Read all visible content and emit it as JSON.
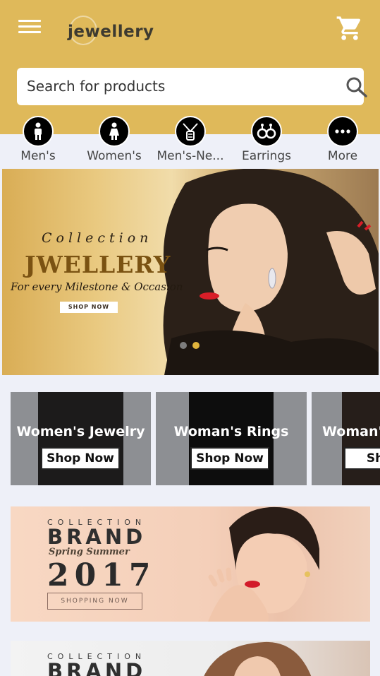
{
  "header": {
    "logo_text": "jewellery",
    "menu_icon": "hamburger-menu-icon",
    "cart_icon": "shopping-cart-icon",
    "background": "#dfb95a"
  },
  "search": {
    "placeholder": "Search for products",
    "value": ""
  },
  "categories": [
    {
      "label": "Men's",
      "icon": "man-icon"
    },
    {
      "label": "Women's",
      "icon": "woman-icon"
    },
    {
      "label": "Men's-Ne...",
      "icon": "necklace-icon"
    },
    {
      "label": "Earrings",
      "icon": "earrings-icon"
    },
    {
      "label": "More",
      "icon": "more-dots-icon"
    }
  ],
  "hero": {
    "collection": "Collection",
    "title": "JWELLERY",
    "subtitle": "For every Milestone & Occasion",
    "button": "SHOP NOW",
    "active_slide": 2,
    "total_slides": 2
  },
  "promos": [
    {
      "title": "Women's Jewelry",
      "button": "Shop Now"
    },
    {
      "title": "Woman's Rings",
      "button": "Shop Now"
    },
    {
      "title": "Woman's",
      "button": "Shop"
    }
  ],
  "banner2": {
    "collection": "COLLECTION",
    "brand": "BRAND",
    "season": "Spring Summer",
    "year": "2017",
    "button": "SHOPPING NOW"
  },
  "banner3": {
    "collection": "COLLECTION",
    "brand": "BRAND"
  }
}
